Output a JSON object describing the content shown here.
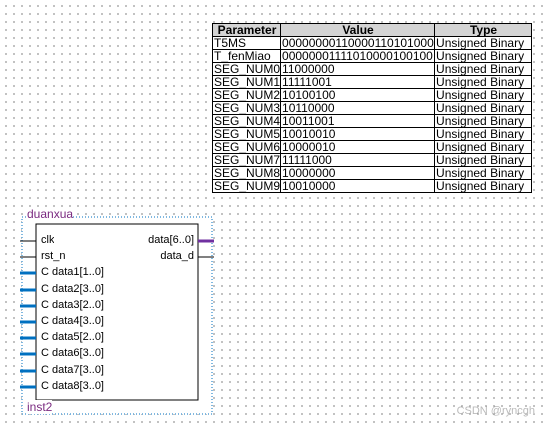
{
  "parameter_table": {
    "headers": [
      "Parameter",
      "Value",
      "Type"
    ],
    "rows": [
      [
        "T5MS",
        "00000000110000110101000",
        "Unsigned Binary"
      ],
      [
        "T_fenMiao",
        "00000001111010000100100",
        "Unsigned Binary"
      ],
      [
        "SEG_NUM0",
        "11000000",
        "Unsigned Binary"
      ],
      [
        "SEG_NUM1",
        "11111001",
        "Unsigned Binary"
      ],
      [
        "SEG_NUM2",
        "10100100",
        "Unsigned Binary"
      ],
      [
        "SEG_NUM3",
        "10110000",
        "Unsigned Binary"
      ],
      [
        "SEG_NUM4",
        "10011001",
        "Unsigned Binary"
      ],
      [
        "SEG_NUM5",
        "10010010",
        "Unsigned Binary"
      ],
      [
        "SEG_NUM6",
        "10000010",
        "Unsigned Binary"
      ],
      [
        "SEG_NUM7",
        "11111000",
        "Unsigned Binary"
      ],
      [
        "SEG_NUM8",
        "10000000",
        "Unsigned Binary"
      ],
      [
        "SEG_NUM9",
        "10010000",
        "Unsigned Binary"
      ]
    ]
  },
  "block": {
    "name": "duanxua",
    "instance": "inst2",
    "input_pins": [
      {
        "label": "clk",
        "bus": false
      },
      {
        "label": "rst_n",
        "bus": false
      },
      {
        "label": "C  data1[1..0]",
        "bus": true
      },
      {
        "label": "C  data2[3..0]",
        "bus": true
      },
      {
        "label": "C  data3[2..0]",
        "bus": true
      },
      {
        "label": "C  data4[3..0]",
        "bus": true
      },
      {
        "label": "C  data5[2..0]",
        "bus": true
      },
      {
        "label": "C  data6[3..0]",
        "bus": true
      },
      {
        "label": "C  data7[3..0]",
        "bus": true
      },
      {
        "label": "C  data8[3..0]",
        "bus": true
      }
    ],
    "output_pins": [
      {
        "label": "data[6..0]",
        "bus": true
      },
      {
        "label": "data_d",
        "bus": false
      }
    ]
  },
  "colors": {
    "bus_pin": "#0070c0",
    "output_bus": "#7030a0",
    "block_text": "#7a2a80",
    "header_bg": "#d4d4d4"
  },
  "watermark": "CSDN @ryncgh"
}
